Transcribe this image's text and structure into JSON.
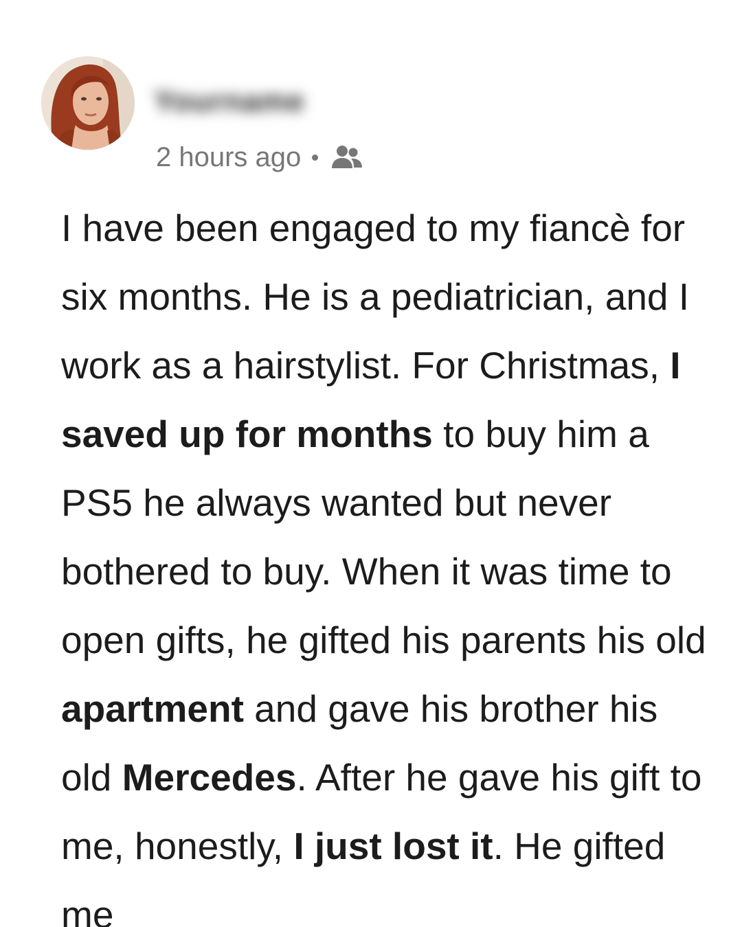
{
  "post": {
    "author": {
      "name": "Yourname",
      "avatar_icon": "profile-photo"
    },
    "timestamp": "2 hours ago",
    "audience_icon": "friends-icon",
    "body": [
      {
        "text": "I have been engaged to my fiancè for six months. He is a pediatrician, and I work as a hairstylist. For Christmas, ",
        "bold": false
      },
      {
        "text": "I saved up for months",
        "bold": true
      },
      {
        "text": " to buy him a PS5 he always wanted but never bothered to buy. When it was time to open gifts, he gifted his parents his old ",
        "bold": false
      },
      {
        "text": "apartment",
        "bold": true
      },
      {
        "text": " and gave his brother his old ",
        "bold": false
      },
      {
        "text": "Mercedes",
        "bold": true
      },
      {
        "text": ". After he gave his gift to me, honestly, ",
        "bold": false
      },
      {
        "text": "I just lost it",
        "bold": true
      },
      {
        "text": ". He gifted me",
        "bold": false
      }
    ]
  },
  "colors": {
    "text": "#1c1c1c",
    "meta": "#777777",
    "background": "#ffffff"
  }
}
